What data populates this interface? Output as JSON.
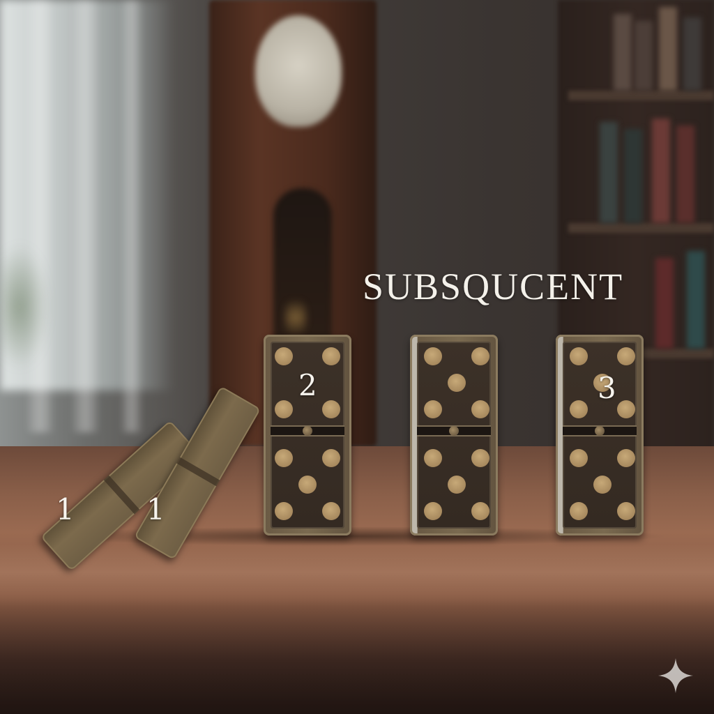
{
  "scene": {
    "headline": "SUBSQUCENT",
    "domino_labels": {
      "fallen_first": "1",
      "fallen_second": "1",
      "standing_first": "2",
      "standing_third": "3"
    },
    "colors": {
      "headline_text": "#f4f1ea",
      "domino_face": "#342a22",
      "domino_pip": "#b0915f",
      "table_wood": "#9a6a51"
    },
    "icons": [
      "sparkle-icon"
    ]
  }
}
